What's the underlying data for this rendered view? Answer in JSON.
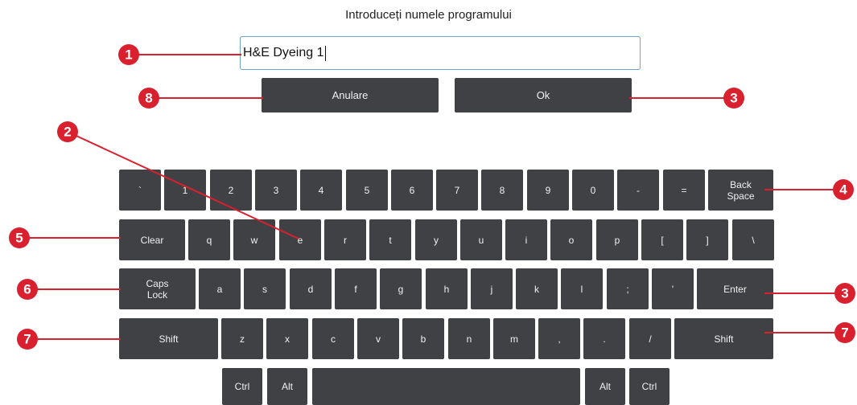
{
  "dialog": {
    "title": "Introduceți numele programului",
    "input_value": "H&E Dyeing 1",
    "cancel_label": "Anulare",
    "ok_label": "Ok"
  },
  "keyboard": {
    "row1": [
      "`",
      "1",
      "2",
      "3",
      "4",
      "5",
      "6",
      "7",
      "8",
      "9",
      "0",
      "-",
      "="
    ],
    "backspace": "Back\nSpace",
    "row2": [
      "q",
      "w",
      "e",
      "r",
      "t",
      "y",
      "u",
      "i",
      "o",
      "p",
      "[",
      "]",
      "\\"
    ],
    "clear": "Clear",
    "caps": "Caps\nLock",
    "row3": [
      "a",
      "s",
      "d",
      "f",
      "g",
      "h",
      "j",
      "k",
      "l",
      ";",
      "'"
    ],
    "enter": "Enter",
    "shift": "Shift",
    "row4": [
      "z",
      "x",
      "c",
      "v",
      "b",
      "n",
      "m",
      ",",
      ".",
      "/"
    ],
    "ctrl": "Ctrl",
    "alt": "Alt"
  },
  "callouts": [
    "1",
    "2",
    "3",
    "4",
    "5",
    "6",
    "7",
    "8"
  ],
  "colors": {
    "callout": "#d9202e",
    "key": "#404145",
    "input_border": "#6fa3c8"
  }
}
